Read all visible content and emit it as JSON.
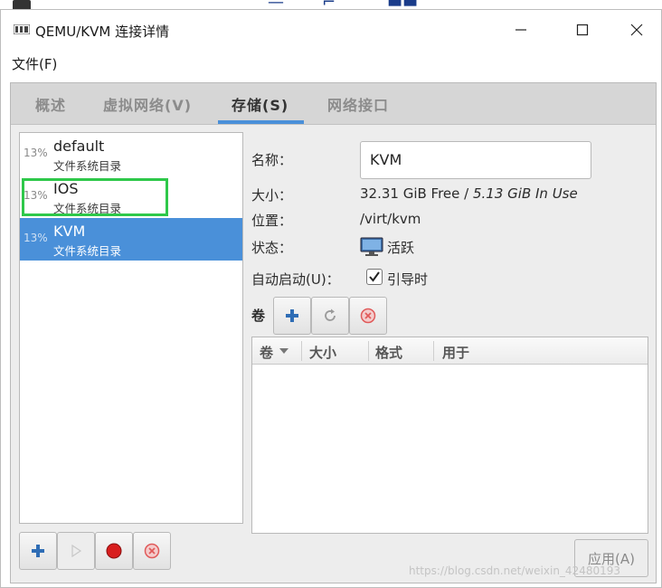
{
  "window": {
    "title": "QEMU/KVM 连接详情"
  },
  "menubar": {
    "file": "文件(F)"
  },
  "tabs": [
    {
      "label": "概述"
    },
    {
      "label": "虚拟网络(V)"
    },
    {
      "label": "存储(S)"
    },
    {
      "label": "网络接口"
    }
  ],
  "pools": [
    {
      "percent": "13%",
      "name": "default",
      "type": "文件系统目录"
    },
    {
      "percent": "13%",
      "name": "IOS",
      "type": "文件系统目录"
    },
    {
      "percent": "13%",
      "name": "KVM",
      "type": "文件系统目录"
    }
  ],
  "details": {
    "name_label": "名称：",
    "name_value": "KVM",
    "size_label": "大小：",
    "size_free": "32.31 GiB Free / ",
    "size_inuse": "5.13 GiB In Use",
    "location_label": "位置：",
    "location_value": "/virt/kvm",
    "state_label": "状态：",
    "state_value": "活跃",
    "autostart_label": "自动启动(U)：",
    "autostart_value": "引导时"
  },
  "volumes": {
    "label": "卷",
    "columns": [
      "卷",
      "大小",
      "格式",
      "用于"
    ]
  },
  "apply_label": "应用(A)",
  "watermark": "https://blog.csdn.net/weixin_42480193",
  "colors": {
    "selection": "#4a90d9",
    "highlight_box": "#2ec84a",
    "add_icon": "#2f6db5",
    "stop_icon": "#d81e1e",
    "delete_icon": "#e05a5a"
  }
}
